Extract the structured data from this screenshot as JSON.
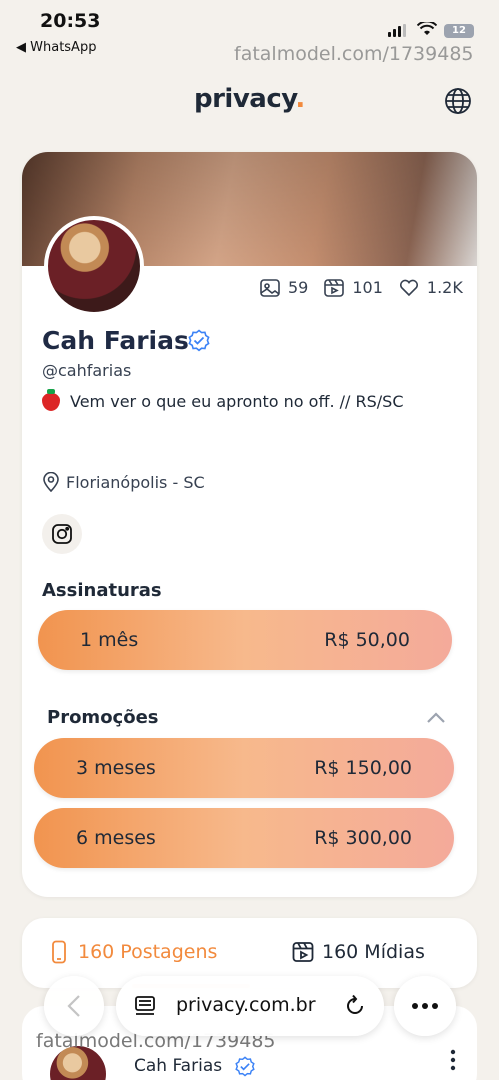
{
  "status_bar": {
    "time": "20:53",
    "back_app": "◀ WhatsApp",
    "battery": "12"
  },
  "watermark": {
    "top": "fatalmodel.com/1739485",
    "bottom": "fatalmodel.com/1739485",
    "brand": "fatalmodel"
  },
  "header": {
    "logo": "privacy",
    "logo_dot": "."
  },
  "profile": {
    "stats": {
      "photos": "59",
      "videos": "101",
      "likes": "1.2K"
    },
    "name": "Cah Farias",
    "handle": "@cahfarias",
    "bio": "Vem ver o que eu apronto no off. // RS/SC",
    "location": "Florianópolis - SC"
  },
  "subscriptions": {
    "title": "Assinaturas",
    "plans": [
      {
        "label": "1 mês",
        "price": "R$ 50,00"
      }
    ]
  },
  "promotions": {
    "title": "Promoções",
    "plans": [
      {
        "label": "3 meses",
        "price": "R$ 150,00"
      },
      {
        "label": "6 meses",
        "price": "R$ 300,00"
      }
    ]
  },
  "tabs": {
    "posts": "160 Postagens",
    "media": "160 Mídias"
  },
  "post_preview": {
    "name": "Cah Farias"
  },
  "browser": {
    "url": "privacy.com.br"
  },
  "colors": {
    "accent": "#f28a3d",
    "verified": "#3b82f6"
  }
}
